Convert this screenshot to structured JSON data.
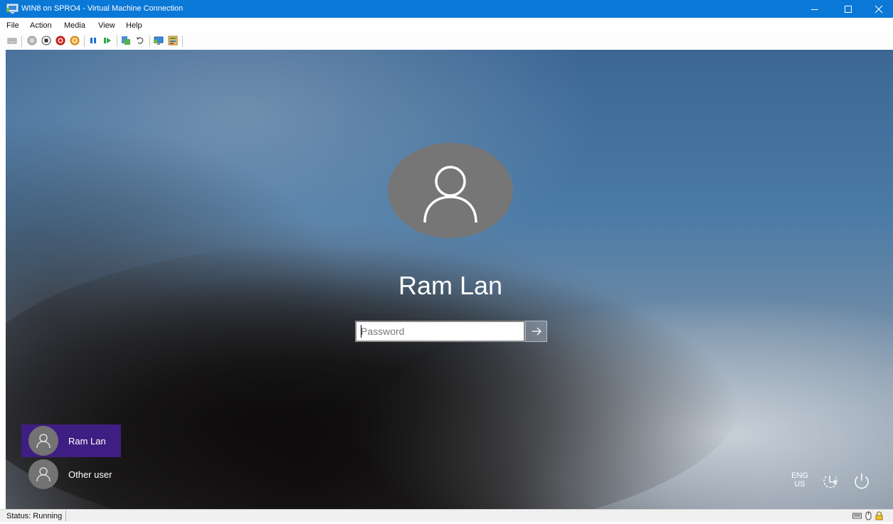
{
  "window": {
    "title": "WIN8 on SPRO4 - Virtual Machine Connection",
    "controls": [
      "minimize-icon",
      "maximize-icon",
      "close-icon"
    ]
  },
  "menu": {
    "items": [
      "File",
      "Action",
      "Media",
      "View",
      "Help"
    ]
  },
  "toolbar": {
    "buttons": [
      "ctrl-alt-del-icon",
      "start-icon",
      "turn-off-icon",
      "shut-down-icon",
      "save-icon",
      "pause-icon",
      "reset-icon",
      "checkpoint-icon",
      "revert-icon",
      "enhanced-session-icon",
      "settings-icon"
    ]
  },
  "login": {
    "username": "Ram Lan",
    "password_placeholder": "Password",
    "submit_icon": "arrow-right-icon"
  },
  "users": [
    {
      "label": "Ram Lan",
      "selected": true
    },
    {
      "label": "Other user",
      "selected": false
    }
  ],
  "system": {
    "lang_line1": "ENG",
    "lang_line2": "US",
    "ease_icon": "ease-of-access-icon",
    "power_icon": "power-icon"
  },
  "status": {
    "text": "Status: Running",
    "icons": [
      "keyboard-icon",
      "mouse-icon",
      "lock-icon"
    ]
  },
  "colors": {
    "titlebar": "#0a78d7",
    "selected_tile": "#3f1e83",
    "avatar": "#767676"
  }
}
